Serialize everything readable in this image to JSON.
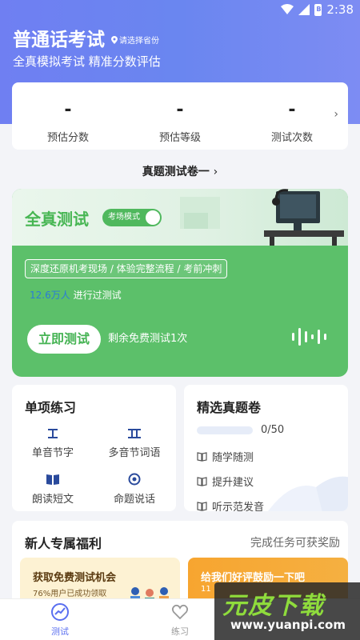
{
  "status_bar": {
    "time": "2:38",
    "battery_label": "B"
  },
  "header": {
    "title": "普通话考试",
    "province_hint": "请选择省份",
    "subtitle": "全真模拟考试 精准分数评估"
  },
  "stats": [
    {
      "value": "-",
      "label": "预估分数"
    },
    {
      "value": "-",
      "label": "预估等级"
    },
    {
      "value": "-",
      "label": "测试次数"
    }
  ],
  "paper_select": "真题测试卷一",
  "full_test": {
    "title": "全真测试",
    "mode_label": "考场模式",
    "mode_on": true,
    "features": "深度还原机考现场 / 体验完整流程 / 考前冲刺",
    "tested_count": "12.6万人",
    "tested_suffix": "进行过测试",
    "start_button": "立即测试",
    "free_left": "剩余免费测试1次"
  },
  "single_practice": {
    "title": "单项练习",
    "items": [
      {
        "label": "单音节字",
        "icon": "single-char-icon"
      },
      {
        "label": "多音节词语",
        "icon": "multi-syllable-icon"
      },
      {
        "label": "朗读短文",
        "icon": "book-icon"
      },
      {
        "label": "命题说话",
        "icon": "speech-icon"
      }
    ]
  },
  "selected_papers": {
    "title": "精选真题卷",
    "progress_text": "0/50",
    "progress_fraction": 0,
    "links": [
      "随学随测",
      "提升建议",
      "听示范发音"
    ]
  },
  "newbie": {
    "title": "新人专属福利",
    "hint": "完成任务可获奖励",
    "promo1_title": "获取免费测试机会",
    "promo1_sub": "76%用户已成功领取",
    "promo2_title": "给我们好评鼓励一下吧",
    "promo2_sub": "11"
  },
  "bottom_nav": [
    {
      "label": "测试",
      "active": true
    },
    {
      "label": "练习",
      "active": false
    }
  ],
  "watermark": {
    "logo": "元皮下载",
    "url": "www.yuanpi.com"
  },
  "colors": {
    "primary": "#6f7ff2",
    "green": "#5cc06a",
    "accent_blue": "#2a7bd8"
  }
}
